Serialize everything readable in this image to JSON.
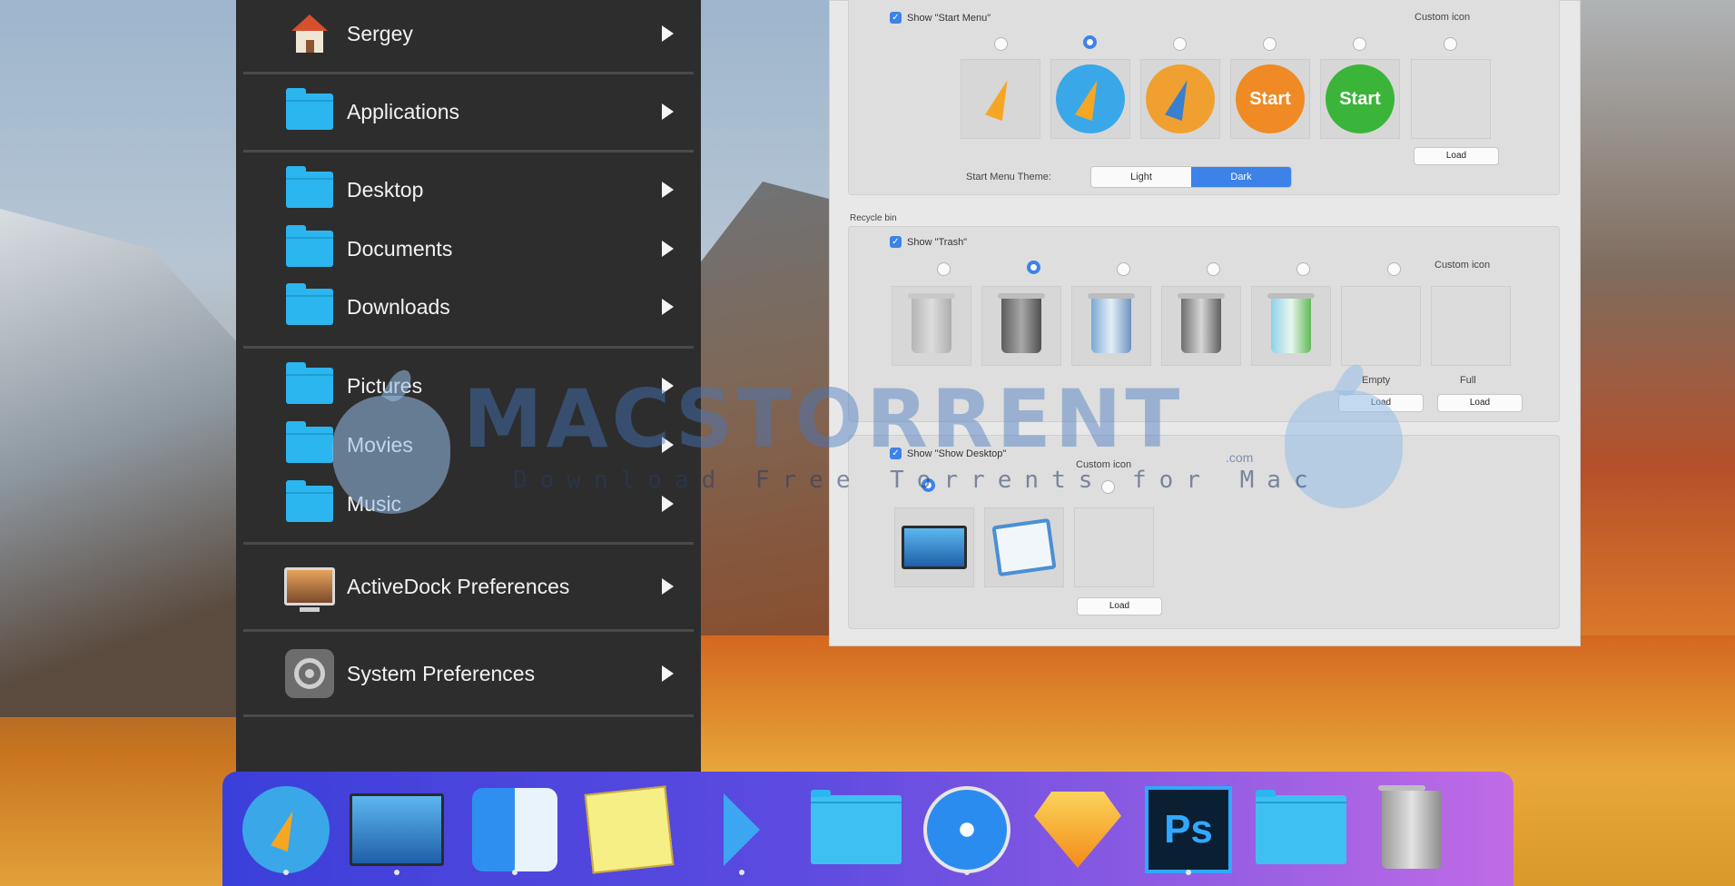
{
  "start_menu": {
    "items": [
      {
        "label": "Sergey",
        "icon": "home-icon"
      },
      {
        "label": "Applications",
        "icon": "folder-icon"
      },
      {
        "label": "Desktop",
        "icon": "folder-icon"
      },
      {
        "label": "Documents",
        "icon": "folder-icon"
      },
      {
        "label": "Downloads",
        "icon": "folder-icon"
      },
      {
        "label": "Pictures",
        "icon": "folder-icon"
      },
      {
        "label": "Movies",
        "icon": "folder-icon"
      },
      {
        "label": "Music",
        "icon": "folder-icon"
      },
      {
        "label": "ActiveDock Preferences",
        "icon": "activedock-preferences-icon"
      },
      {
        "label": "System Preferences",
        "icon": "system-preferences-icon"
      }
    ]
  },
  "preferences": {
    "start_menu_section": {
      "show_checkbox_label": "Show \"Start Menu\"",
      "custom_icon_label": "Custom icon",
      "tile_texts": [
        "",
        "",
        "",
        "Start",
        "Start",
        ""
      ],
      "load_label": "Load",
      "theme_label": "Start Menu Theme:",
      "theme_options": [
        "Light",
        "Dark"
      ],
      "theme_selected": "Dark"
    },
    "recycle_bin_section": {
      "title": "Recycle bin",
      "show_checkbox_label": "Show \"Trash\"",
      "custom_icon_label": "Custom icon",
      "empty_label": "Empty",
      "full_label": "Full",
      "load_label": "Load"
    },
    "show_desktop_section": {
      "show_checkbox_label": "Show \"Show Desktop\"",
      "custom_icon_label": "Custom icon",
      "load_label": "Load"
    }
  },
  "watermark": {
    "title": "MACSTORRENT",
    "com": ".com",
    "subtitle": "Download Free Torrents for Mac"
  },
  "dock": {
    "items": [
      "rocket-icon",
      "desktop-screen-icon",
      "finder-icon",
      "stickies-icon",
      "activedock-icon",
      "downloads-folder-icon",
      "safari-icon",
      "sketch-icon",
      "photoshop-icon",
      "folder-icon",
      "trash-icon"
    ],
    "photoshop_label": "Ps"
  },
  "colors": {
    "accent": "#3d82e8",
    "menu_bg": "#2d2d2d",
    "folder": "#2bb6ef",
    "start_orange": "#f08a24",
    "start_green": "#3ab53a"
  }
}
